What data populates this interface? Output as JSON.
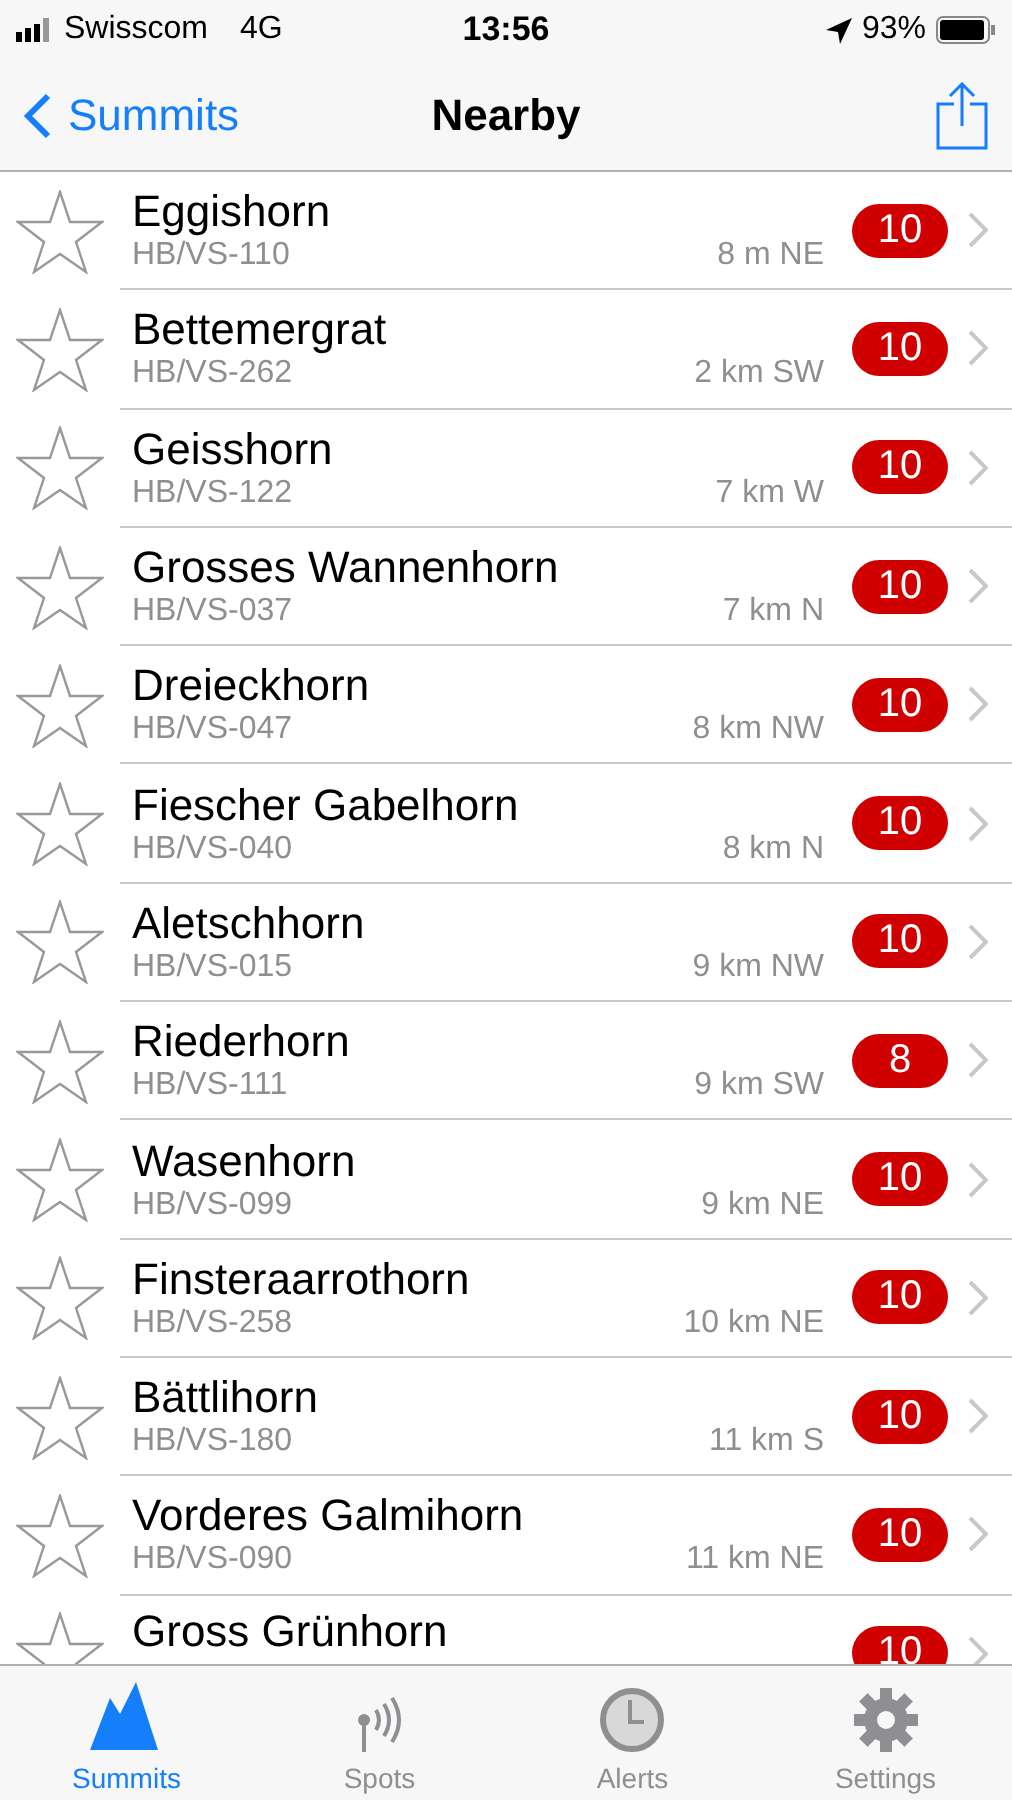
{
  "status_bar": {
    "carrier": "Swisscom",
    "network": "4G",
    "time": "13:56",
    "battery": "93%"
  },
  "nav": {
    "back": "Summits",
    "title": "Nearby"
  },
  "rows": [
    {
      "name": "Eggishorn",
      "ref": "HB/VS-110",
      "distance": "8 m NE",
      "points": "10",
      "starred": false
    },
    {
      "name": "Bettemergrat",
      "ref": "HB/VS-262",
      "distance": "2 km SW",
      "points": "10",
      "starred": false
    },
    {
      "name": "Geisshorn",
      "ref": "HB/VS-122",
      "distance": "7 km W",
      "points": "10",
      "starred": false
    },
    {
      "name": "Grosses Wannenhorn",
      "ref": "HB/VS-037",
      "distance": "7 km N",
      "points": "10",
      "starred": false
    },
    {
      "name": "Dreieckhorn",
      "ref": "HB/VS-047",
      "distance": "8 km NW",
      "points": "10",
      "starred": false
    },
    {
      "name": "Fiescher Gabelhorn",
      "ref": "HB/VS-040",
      "distance": "8 km N",
      "points": "10",
      "starred": false
    },
    {
      "name": "Aletschhorn",
      "ref": "HB/VS-015",
      "distance": "9 km NW",
      "points": "10",
      "starred": false
    },
    {
      "name": "Riederhorn",
      "ref": "HB/VS-111",
      "distance": "9 km SW",
      "points": "8",
      "starred": false
    },
    {
      "name": "Wasenhorn",
      "ref": "HB/VS-099",
      "distance": "9 km NE",
      "points": "10",
      "starred": false
    },
    {
      "name": "Finsteraarrothorn",
      "ref": "HB/VS-258",
      "distance": "10 km NE",
      "points": "10",
      "starred": false
    },
    {
      "name": "Bättlihorn",
      "ref": "HB/VS-180",
      "distance": "11 km S",
      "points": "10",
      "starred": false
    },
    {
      "name": "Vorderes Galmihorn",
      "ref": "HB/VS-090",
      "distance": "11 km NE",
      "points": "10",
      "starred": false
    },
    {
      "name": "Gross Grünhorn",
      "points": "10",
      "starred": false
    }
  ],
  "tabs": [
    {
      "kind": "mountain",
      "label": "Summits",
      "selected": true
    },
    {
      "kind": "antenna",
      "label": "Spots",
      "selected": false
    },
    {
      "kind": "clock",
      "label": "Alerts",
      "selected": false
    },
    {
      "kind": "gear",
      "label": "Settings",
      "selected": false
    }
  ]
}
